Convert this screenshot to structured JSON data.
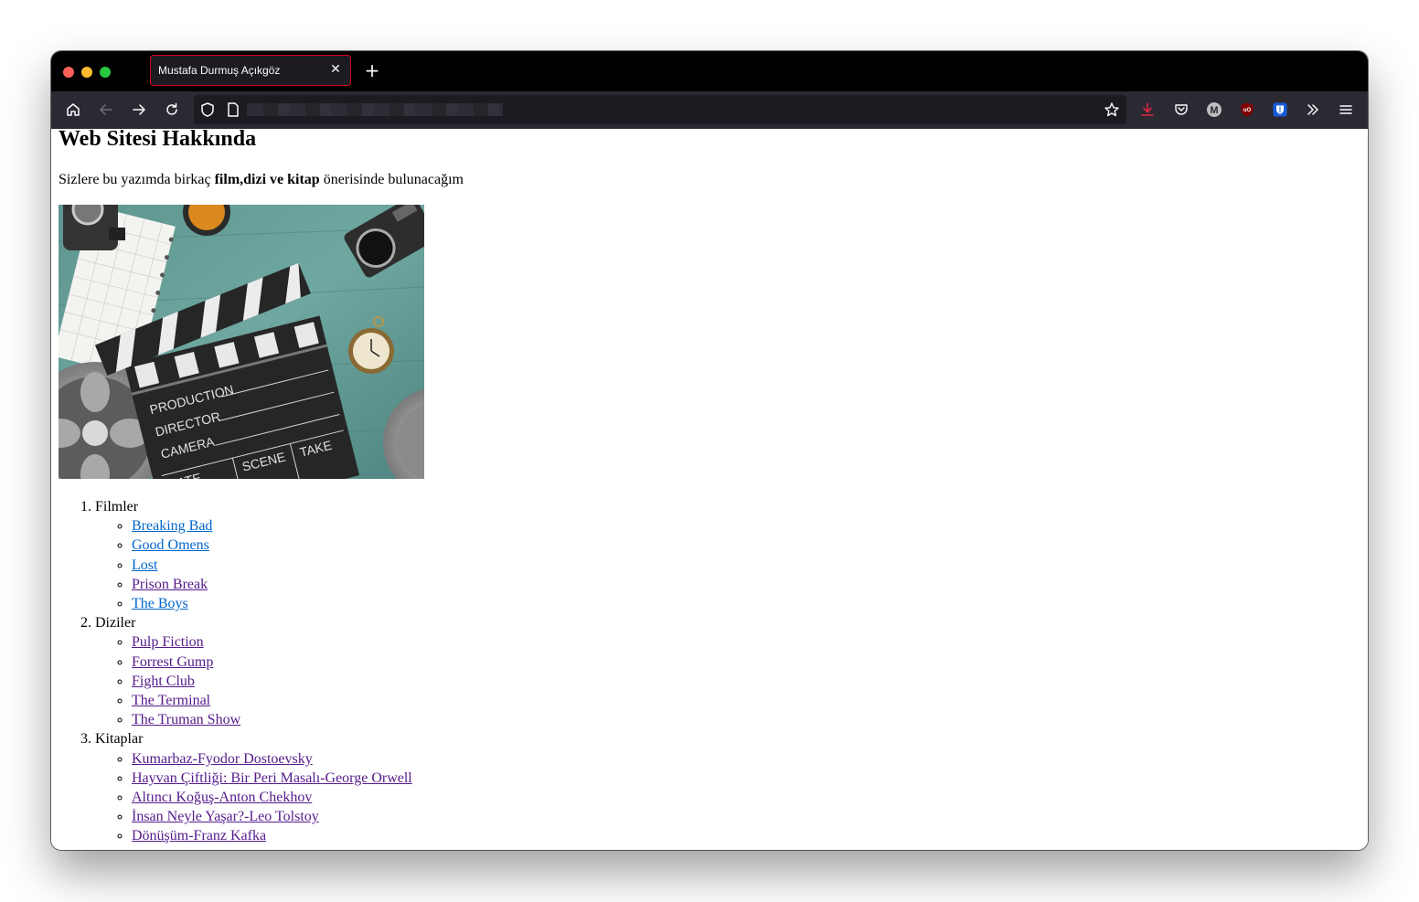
{
  "browser": {
    "tab_title": "Mustafa Durmuş Açıkgöz",
    "tab_close": "✕",
    "new_tab": "+"
  },
  "icons": {
    "home": "home-icon",
    "back": "back-arrow-icon",
    "forward": "forward-arrow-icon",
    "reload": "reload-icon",
    "shield": "shield-icon",
    "page": "page-icon",
    "bookmark": "star-icon",
    "downloads": "download-icon",
    "pocket": "pocket-icon",
    "extension_m": "extension-m-icon",
    "ublock": "ublock-icon",
    "bitwarden": "bitwarden-icon",
    "overflow": "chevrons-icon",
    "menu": "hamburger-menu-icon"
  },
  "colors": {
    "tab_border": "#d70022",
    "download_icon": "#e0263a",
    "link": "#0066cc",
    "visited_link": "#551a8b"
  },
  "page": {
    "title": "Web Sitesi Hakkında",
    "intro_before": "Sizlere bu yazımda birkaç ",
    "intro_bold": "film,dizi ve kitap",
    "intro_after": " önerisinde bulunacağım",
    "sections": [
      {
        "number": "1.",
        "title": "Filmler",
        "items": [
          {
            "label": "Breaking Bad",
            "visited": false
          },
          {
            "label": "Good Omens",
            "visited": false
          },
          {
            "label": "Lost",
            "visited": false
          },
          {
            "label": "Prison Break",
            "visited": true
          },
          {
            "label": "The Boys",
            "visited": false
          }
        ]
      },
      {
        "number": "2.",
        "title": "Diziler",
        "items": [
          {
            "label": "Pulp Fiction",
            "visited": true
          },
          {
            "label": "Forrest Gump",
            "visited": true
          },
          {
            "label": "Fight Club",
            "visited": true
          },
          {
            "label": "The Terminal",
            "visited": true
          },
          {
            "label": "The Truman Show",
            "visited": true
          }
        ]
      },
      {
        "number": "3.",
        "title": "Kitaplar",
        "items": [
          {
            "label": "Kumarbaz-Fyodor Dostoevsky",
            "visited": true
          },
          {
            "label": "Hayvan Çiftliği: Bir Peri Masalı-George Orwell",
            "visited": true
          },
          {
            "label": "Altıncı Koğuş-Anton Chekhov",
            "visited": true
          },
          {
            "label": "İnsan Neyle Yaşar?-Leo Tolstoy",
            "visited": true
          },
          {
            "label": "Dönüşüm-Franz Kafka",
            "visited": true
          }
        ]
      }
    ],
    "hero_image": {
      "subject": "film-clapperboard-photo",
      "labels": [
        "PRODUCTION",
        "DIRECTOR",
        "CAMERA",
        "DATE",
        "SCENE",
        "TAKE"
      ]
    }
  }
}
